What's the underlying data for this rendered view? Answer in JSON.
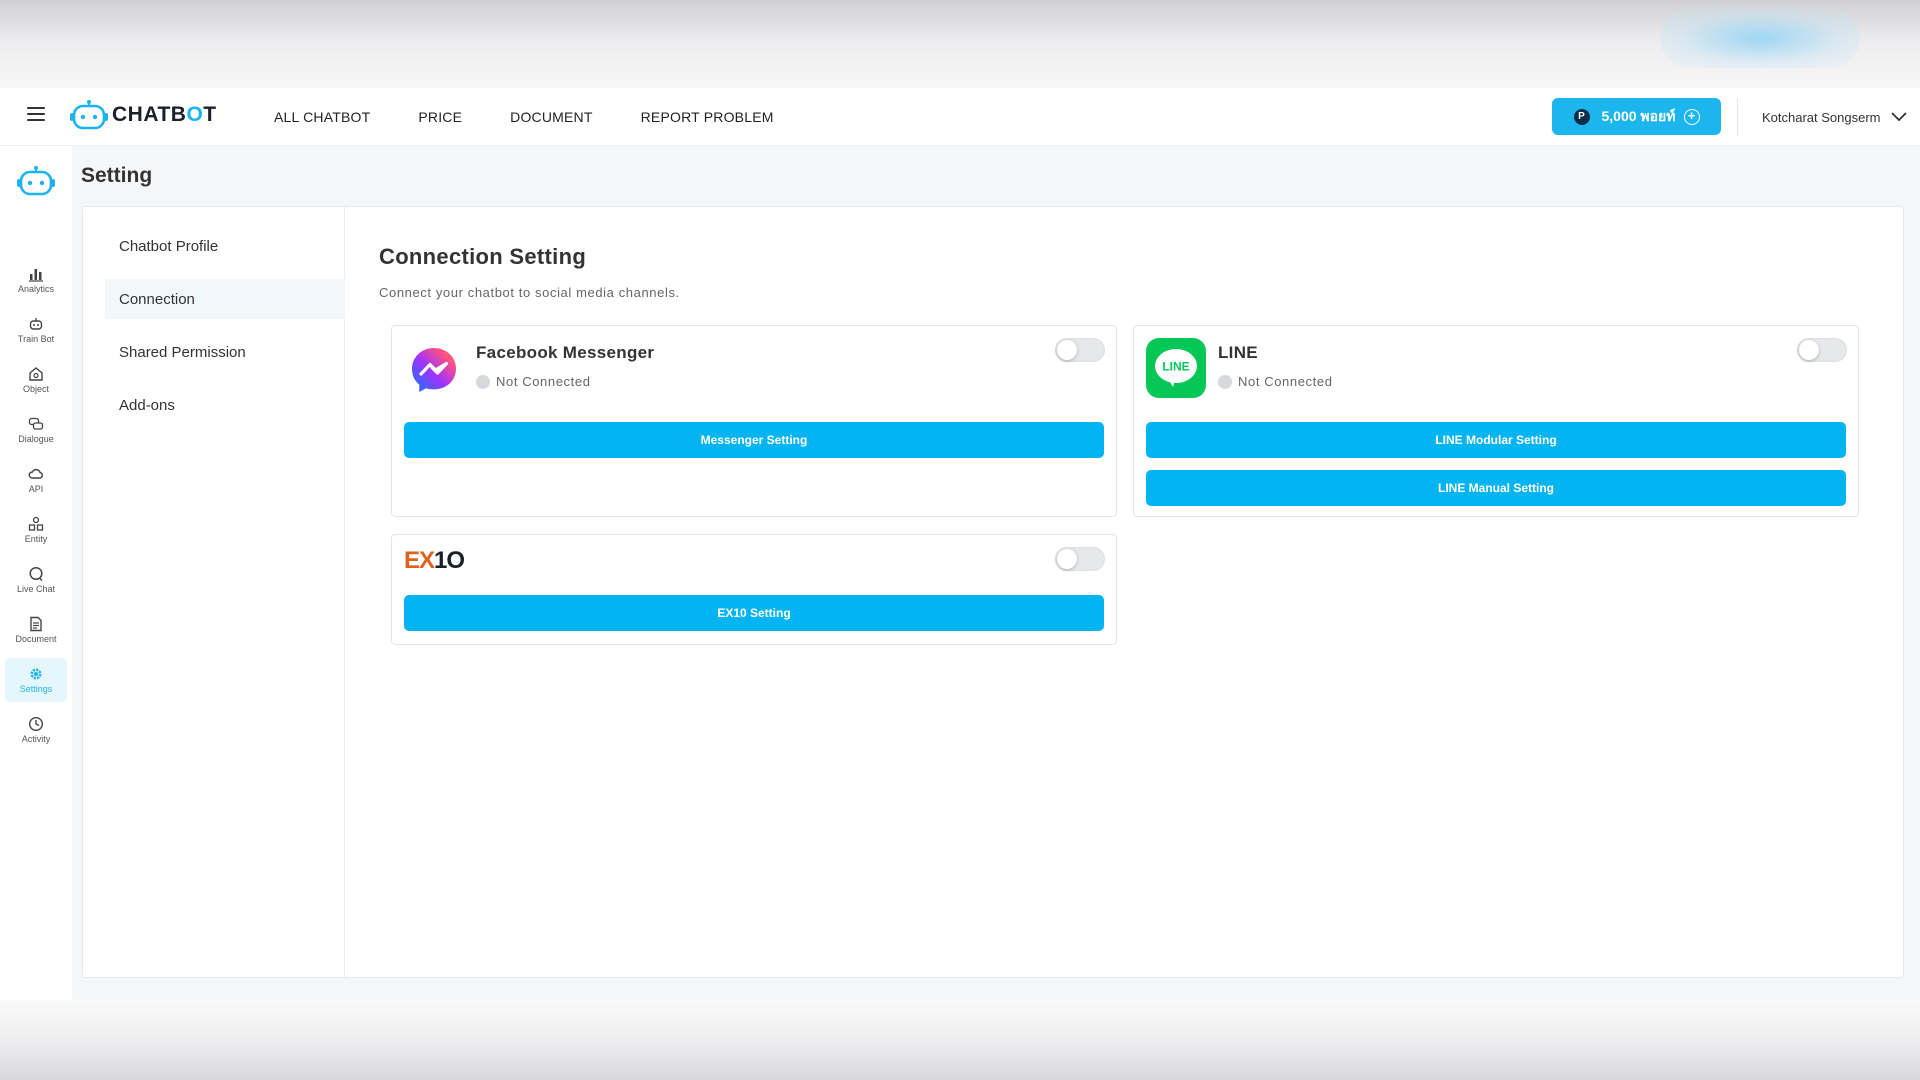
{
  "header": {
    "brand": {
      "name_part1": "CHATB",
      "name_o": "O",
      "name_part2": "T"
    },
    "nav": [
      "ALL CHATBOT",
      "PRICE",
      "DOCUMENT",
      "REPORT PROBLEM"
    ],
    "points": {
      "badge": "P",
      "label": "5,000 พอยท์"
    },
    "user_name": "Kotcharat Songserm"
  },
  "iconbar": {
    "items": [
      {
        "label": "Analytics",
        "icon": "bar-chart-icon"
      },
      {
        "label": "Train Bot",
        "icon": "robot-icon"
      },
      {
        "label": "Object",
        "icon": "object-icon"
      },
      {
        "label": "Dialogue",
        "icon": "chat-bubbles-icon"
      },
      {
        "label": "API",
        "icon": "cloud-icon"
      },
      {
        "label": "Entity",
        "icon": "shapes-icon"
      },
      {
        "label": "Live Chat",
        "icon": "speech-bubble-icon"
      },
      {
        "label": "Document",
        "icon": "document-icon"
      },
      {
        "label": "Settings",
        "icon": "gear-icon",
        "active": true
      },
      {
        "label": "Activity",
        "icon": "clock-icon"
      }
    ]
  },
  "page": {
    "title": "Setting"
  },
  "submenu": {
    "items": [
      "Chatbot Profile",
      "Connection",
      "Shared Permission",
      "Add-ons"
    ],
    "active": "Connection"
  },
  "connection": {
    "title": "Connection Setting",
    "subtitle": "Connect your chatbot to social media channels.",
    "facebook": {
      "name": "Facebook Messenger",
      "status": "Not Connected",
      "button": "Messenger Setting",
      "enabled": false
    },
    "line": {
      "name": "LINE",
      "logo_text": "LINE",
      "status": "Not Connected",
      "button_modular": "LINE Modular Setting",
      "button_manual": "LINE Manual Setting",
      "enabled": false
    },
    "ex10": {
      "logo_part1": "EX",
      "logo_part2": "1O",
      "button": "EX10 Setting",
      "enabled": false
    }
  },
  "colors": {
    "accent": "#03b4f2",
    "brand_dark": "#1b1f2a",
    "line_green": "#06c755",
    "ex10_orange": "#e0621d",
    "active_bg": "#e6f6fd"
  }
}
